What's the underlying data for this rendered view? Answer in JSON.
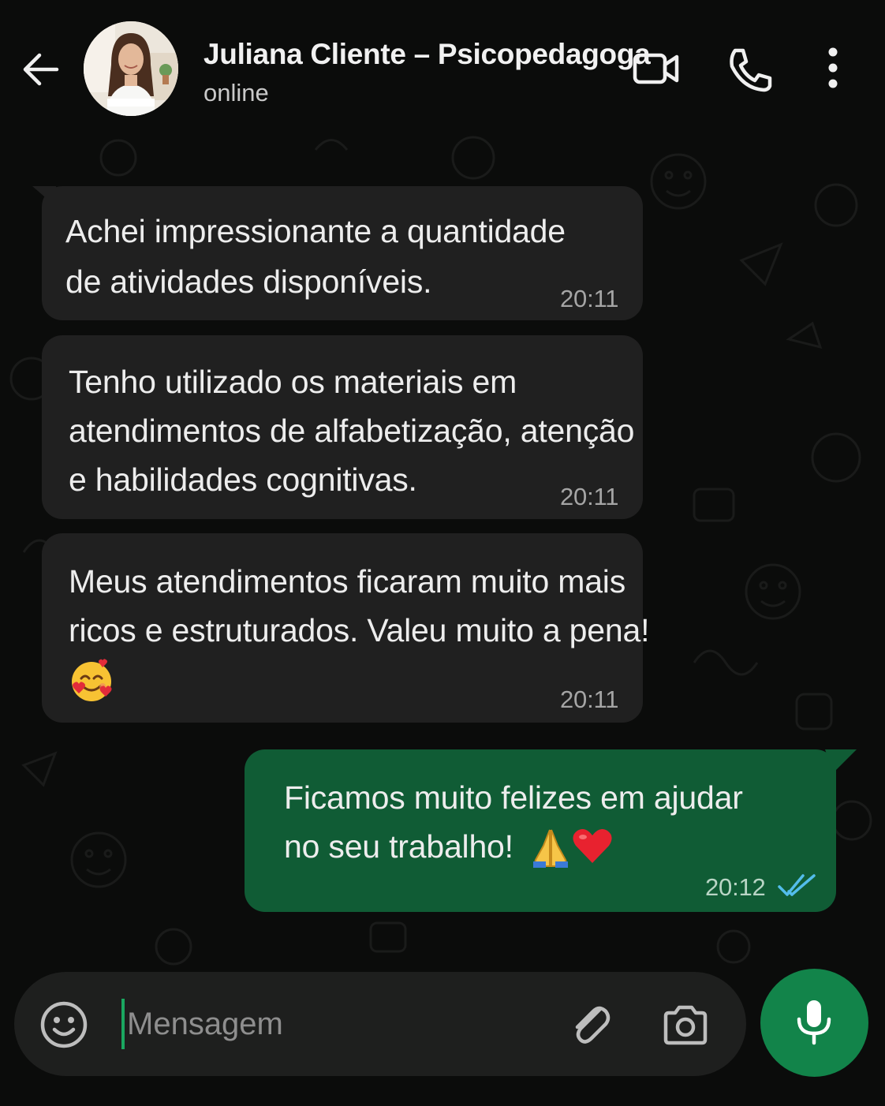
{
  "header": {
    "contact_name": "Juliana Cliente – Psicopedagoga",
    "status": "online",
    "icons": [
      "back-arrow-icon",
      "video-call-icon",
      "phone-icon",
      "more-vert-icon"
    ]
  },
  "messages": [
    {
      "direction": "incoming",
      "lines": [
        "Achei impressionante a quantidade",
        "de atividades disponíveis."
      ],
      "time": "20:11"
    },
    {
      "direction": "incoming",
      "lines": [
        "Tenho utilizado os materiais em",
        "atendimentos de alfabetização, atenção",
        "e habilidades cognitivas."
      ],
      "time": "20:11"
    },
    {
      "direction": "incoming",
      "lines": [
        "Meus atendimentos ficaram muito mais",
        "ricos e estruturados. Valeu muito a pena!"
      ],
      "emoji": "smiling-face-with-hearts",
      "time": "20:11"
    },
    {
      "direction": "outgoing",
      "lines": [
        "Ficamos muito felizes em ajudar",
        "no seu trabalho!"
      ],
      "emoji": [
        "folded-hands",
        "red-heart"
      ],
      "time": "20:12",
      "status": "read"
    }
  ],
  "composer": {
    "placeholder": "Mensagem",
    "value": ""
  },
  "colors": {
    "background": "#0b0c0b",
    "incoming_bubble": "#202020",
    "outgoing_bubble": "#105c35",
    "accent": "#12844a",
    "read_ticks": "#53bdeb"
  }
}
